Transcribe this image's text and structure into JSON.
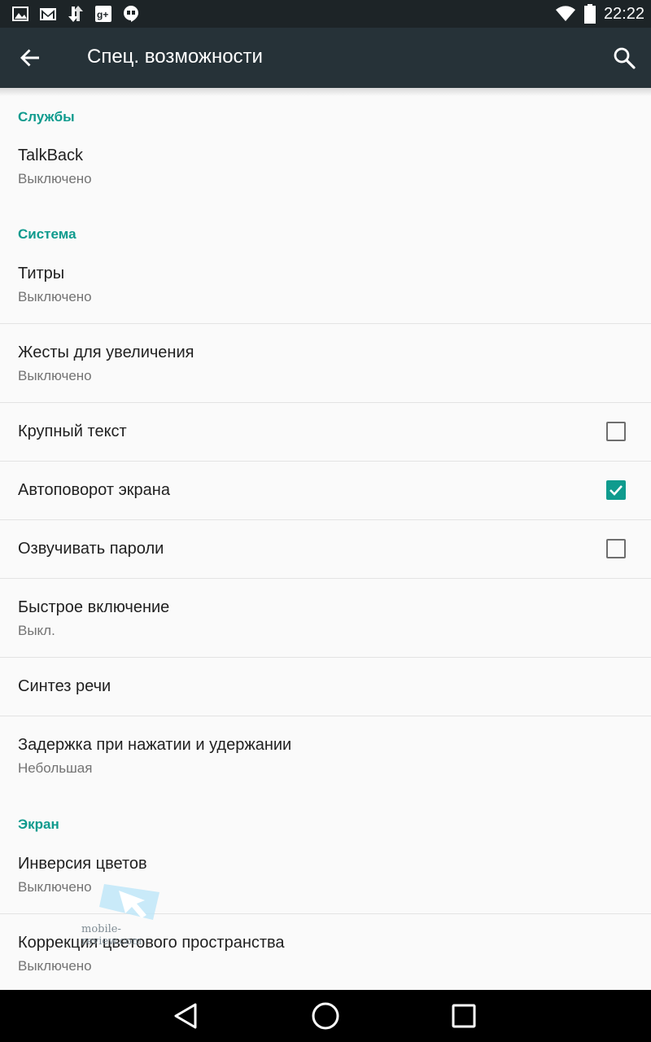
{
  "status_bar": {
    "clock": "22:22",
    "icons_left": [
      "gallery-icon",
      "gmail-icon",
      "sync-icon",
      "google-plus-icon",
      "hangouts-icon"
    ],
    "icons_right": [
      "wifi-icon",
      "battery-icon"
    ]
  },
  "toolbar": {
    "title": "Спец. возможности",
    "back_icon": "arrow-left-icon",
    "search_icon": "search-icon"
  },
  "sections": {
    "services": "Службы",
    "system": "Система",
    "screen": "Экран"
  },
  "items": {
    "talkback": {
      "title": "TalkBack",
      "summary": "Выключено"
    },
    "captions": {
      "title": "Титры",
      "summary": "Выключено"
    },
    "magnification": {
      "title": "Жесты для увеличения",
      "summary": "Выключено"
    },
    "large_text": {
      "title": "Крупный текст",
      "checked": false
    },
    "auto_rotate": {
      "title": "Автоповорот экрана",
      "checked": true
    },
    "speak_passwords": {
      "title": "Озвучивать пароли",
      "checked": false
    },
    "quick_enable": {
      "title": "Быстрое включение",
      "summary": "Выкл."
    },
    "tts": {
      "title": "Синтез речи"
    },
    "touch_hold_delay": {
      "title": "Задержка при нажатии и удержании",
      "summary": "Небольшая"
    },
    "color_inversion": {
      "title": "Инверсия цветов",
      "summary": "Выключено"
    },
    "color_correction": {
      "title": "Коррекция цветового пространства",
      "summary": "Выключено"
    }
  },
  "watermark": {
    "text": "mobile-review.com"
  },
  "colors": {
    "accent": "#0f9b8e",
    "toolbar": "#263238",
    "statusbar": "#1d2427"
  },
  "nav_bar": {
    "icons": [
      "nav-back-icon",
      "nav-home-icon",
      "nav-recents-icon"
    ]
  }
}
